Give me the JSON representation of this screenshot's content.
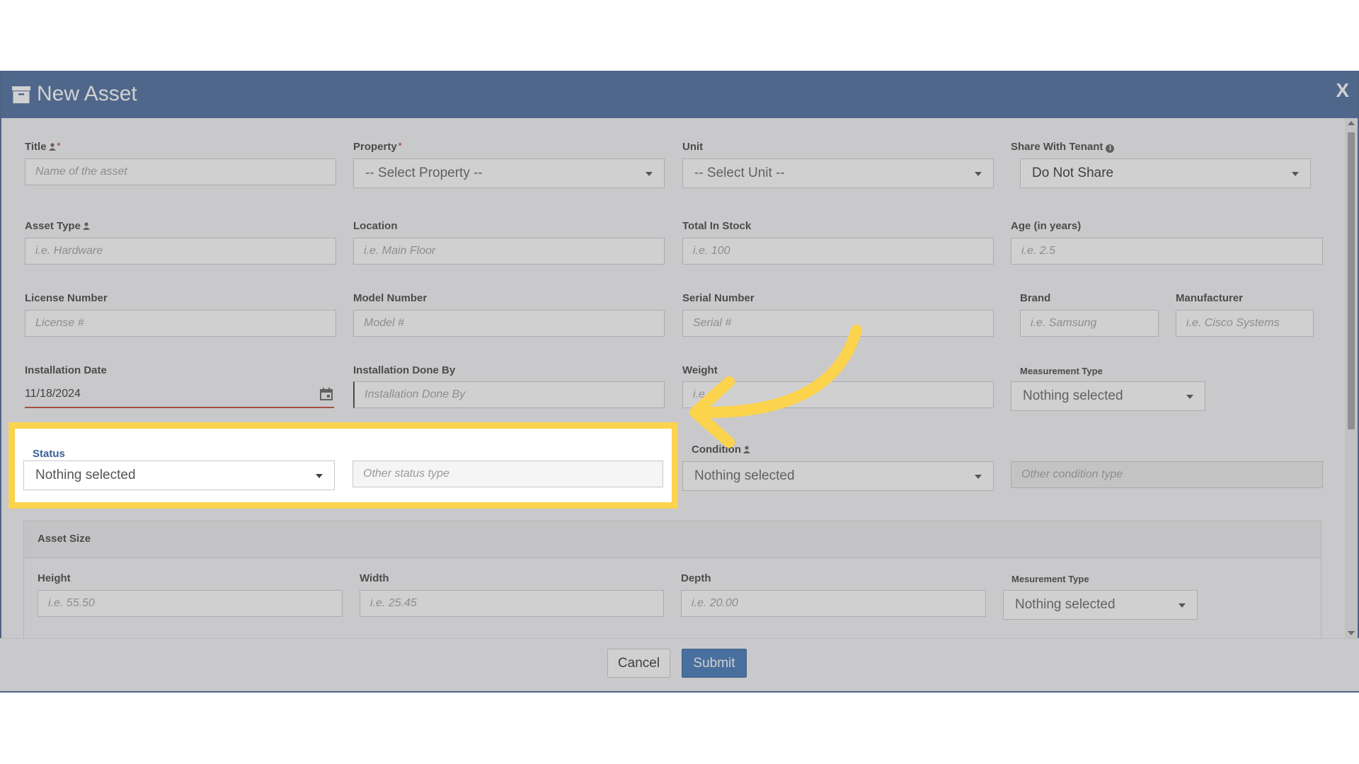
{
  "modal": {
    "title": "New Asset",
    "close_label": "X"
  },
  "fields": {
    "title": {
      "label": "Title",
      "placeholder": "Name of the asset",
      "required": "*"
    },
    "property": {
      "label": "Property",
      "value": "-- Select Property --",
      "required": "*"
    },
    "unit": {
      "label": "Unit",
      "value": "-- Select Unit --"
    },
    "share": {
      "label": "Share With Tenant",
      "value": "Do Not Share"
    },
    "asset_type": {
      "label": "Asset Type",
      "placeholder": "i.e. Hardware"
    },
    "location": {
      "label": "Location",
      "placeholder": "i.e. Main Floor"
    },
    "total_stock": {
      "label": "Total In Stock",
      "placeholder": "i.e. 100"
    },
    "age": {
      "label": "Age (in years)",
      "placeholder": "i.e. 2.5"
    },
    "license": {
      "label": "License Number",
      "placeholder": "License #"
    },
    "model": {
      "label": "Model Number",
      "placeholder": "Model #"
    },
    "serial": {
      "label": "Serial Number",
      "placeholder": "Serial #"
    },
    "brand": {
      "label": "Brand",
      "placeholder": "i.e. Samsung"
    },
    "manufacturer": {
      "label": "Manufacturer",
      "placeholder": "i.e. Cisco Systems"
    },
    "install_date": {
      "label": "Installation Date",
      "value": "11/18/2024"
    },
    "install_by": {
      "label": "Installation Done By",
      "placeholder": "Installation Done By"
    },
    "weight": {
      "label": "Weight",
      "placeholder": "i.e."
    },
    "weight_measure": {
      "label": "Measurement Type",
      "value": "Nothing selected"
    },
    "status": {
      "label": "Status",
      "value": "Nothing selected",
      "other_placeholder": "Other status type"
    },
    "condition": {
      "label": "Condition",
      "value": "Nothing selected",
      "other_placeholder": "Other condition type"
    }
  },
  "asset_size": {
    "heading": "Asset Size",
    "height": {
      "label": "Height",
      "placeholder": "i.e. 55.50"
    },
    "width": {
      "label": "Width",
      "placeholder": "i.e. 25.45"
    },
    "depth": {
      "label": "Depth",
      "placeholder": "i.e. 20.00"
    },
    "measure": {
      "label": "Mesurement Type",
      "value": "Nothing selected"
    }
  },
  "footer": {
    "cancel_label": "Cancel",
    "submit_label": "Submit"
  },
  "colors": {
    "header": "#3a5f96",
    "submit": "#2e6ab1",
    "highlight": "#fcd34d",
    "required": "#c0392b"
  }
}
